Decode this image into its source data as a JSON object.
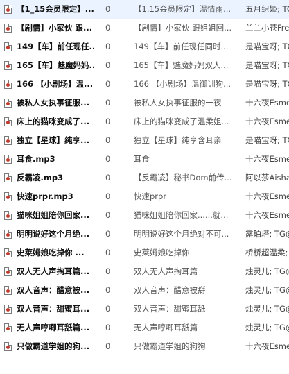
{
  "rows": [
    {
      "title": "【1_15会员限定】...",
      "num": "0",
      "album": "【1.15会员限定】温情雨...",
      "artist": "五月织姬; TC"
    },
    {
      "title": "【剧情】小家伙 跟...",
      "num": "0",
      "album": "【剧情】小家伙 跟姐姐回...",
      "artist": "兰兰小苍Fre"
    },
    {
      "title": "149【车】前任现任...",
      "num": "0",
      "album": "149【车】前任现任同时...",
      "artist": "是喵宝呀; TG"
    },
    {
      "title": "165【车】魅魔妈妈...",
      "num": "0",
      "album": "165【车】魅魔妈妈双人...",
      "artist": "是喵宝呀; TG"
    },
    {
      "title": "166 【小剧场】温...",
      "num": "0",
      "album": "166 【小剧场】温御训狗...",
      "artist": "是喵宝呀; TG"
    },
    {
      "title": "被私人女执事征服...",
      "num": "0",
      "album": "被私人女执事征服的一夜",
      "artist": "十六夜Esme"
    },
    {
      "title": "床上的猫咪变成了...",
      "num": "0",
      "album": "床上的猫咪变成了温柔姐...",
      "artist": "十六夜Esme"
    },
    {
      "title": "独立【星球】纯享...",
      "num": "0",
      "album": "独立【星球】纯享含耳亲",
      "artist": "是喵宝呀; TG"
    },
    {
      "title": "耳食.mp3",
      "num": "0",
      "album": "耳食",
      "artist": "十六夜Esme"
    },
    {
      "title": "反霸凌.mp3",
      "num": "0",
      "album": "【反霸凌】秘书Dom前传...",
      "artist": "阿以莎Aisha"
    },
    {
      "title": "快速prpr.mp3",
      "num": "0",
      "album": "快速prpr",
      "artist": "十六夜Esme"
    },
    {
      "title": "猫咪姐姐陪你回家...",
      "num": "0",
      "album": "猫咪姐姐陪你回家......就...",
      "artist": "十六夜Esme"
    },
    {
      "title": "明明说好这个月绝...",
      "num": "0",
      "album": "明明说好这个月绝对不可...",
      "artist": "露珀塔; TG@"
    },
    {
      "title": "史莱姆娘吃掉你 ...",
      "num": "0",
      "album": "史莱姆娘吃掉你",
      "artist": "桥桥超温柔;"
    },
    {
      "title": "双人无人声掏耳篇...",
      "num": "0",
      "album": "双人无人声掏耳篇",
      "artist": "烛灵儿; TG@"
    },
    {
      "title": "双人音声：醋意被...",
      "num": "0",
      "album": "双人音声：醋意被搿",
      "artist": "烛灵儿; TG@"
    },
    {
      "title": "双人音声：甜蜜耳...",
      "num": "0",
      "album": "双人音声：甜蜜耳舐",
      "artist": "烛灵儿; TG@"
    },
    {
      "title": "无人声哼唧耳舐篇...",
      "num": "0",
      "album": "无人声哼唧耳舐篇",
      "artist": "烛灵儿; TG@"
    },
    {
      "title": "只做霸道学姐的狗...",
      "num": "0",
      "album": "只做霸道学姐的狗狗",
      "artist": "十六夜Esme"
    }
  ]
}
